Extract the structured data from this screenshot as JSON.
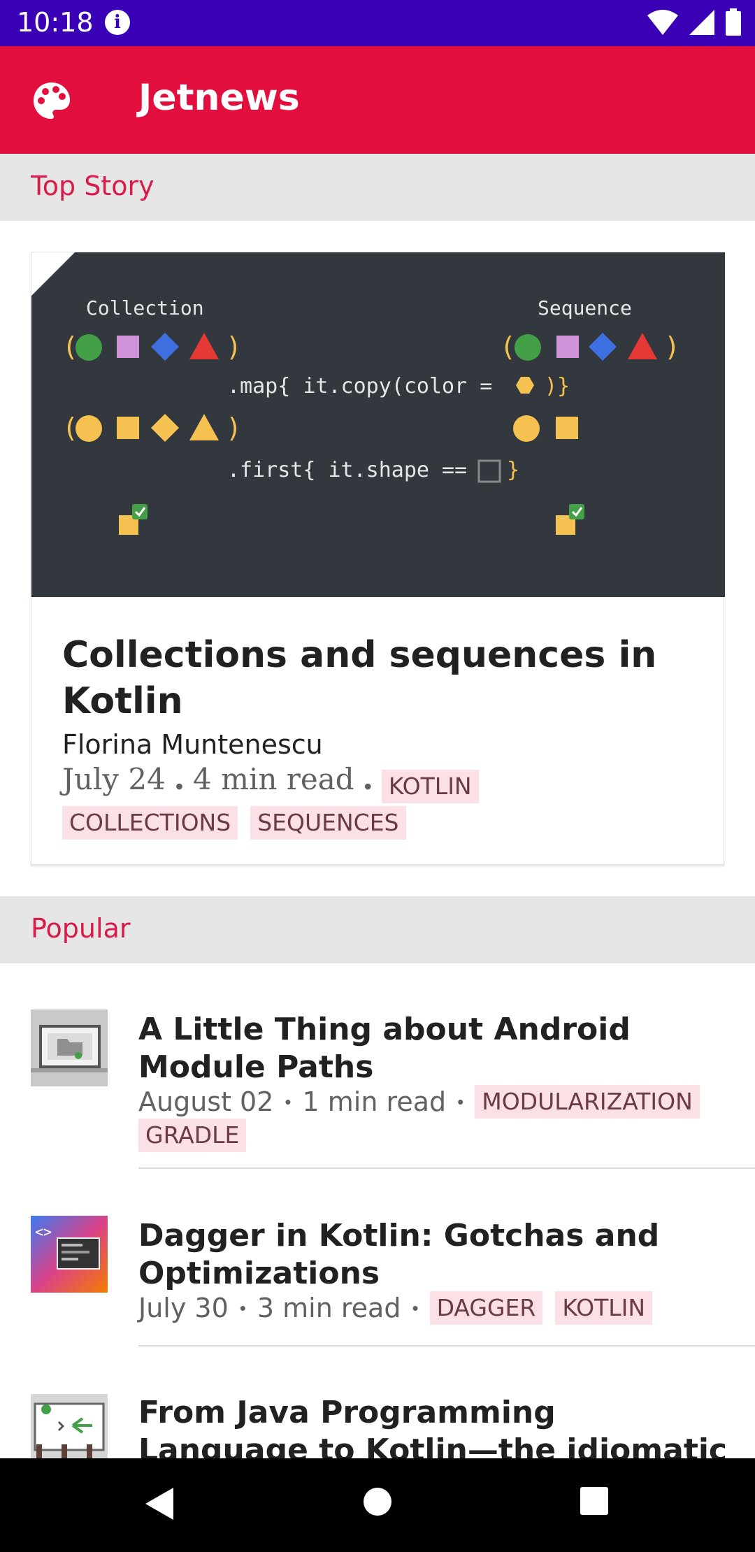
{
  "status_bar": {
    "time": "10:18",
    "info_icon": "info-icon"
  },
  "app_bar": {
    "title": "Jetnews",
    "icon": "palette-icon",
    "color": "#e20e3d"
  },
  "sections": {
    "top_story": "Top Story",
    "popular": "Popular"
  },
  "top_story": {
    "image": {
      "left_label": "Collection",
      "right_label": "Sequence",
      "map_code": ".map{ it.copy(color = ",
      "map_close": ")}",
      "first_code": ".first{ it.shape == ",
      "first_close": "}",
      "paren_open": "(",
      "paren_close": ")"
    },
    "title": "Collections and sequences in Kotlin",
    "author": "Florina Muntenescu",
    "date": "July 24",
    "read_time": "4 min read",
    "tags": [
      "KOTLIN",
      "COLLECTIONS",
      "SEQUENCES"
    ]
  },
  "popular": [
    {
      "title": "A Little Thing about Android Module Paths",
      "date": "August 02",
      "read_time": "1 min read",
      "tags": [
        "MODULARIZATION",
        "GRADLE"
      ]
    },
    {
      "title": "Dagger in Kotlin: Gotchas and Optimizations",
      "date": "July 30",
      "read_time": "3 min read",
      "tags": [
        "DAGGER",
        "KOTLIN"
      ]
    },
    {
      "title": "From Java Programming Language to Kotlin—the idiomatic way",
      "date": "",
      "read_time": "",
      "tags": []
    }
  ],
  "meta_separator": "•",
  "colors": {
    "accent": "#d81b48",
    "tag_bg": "#fbe0e6",
    "status_bar": "#3a00b5"
  }
}
